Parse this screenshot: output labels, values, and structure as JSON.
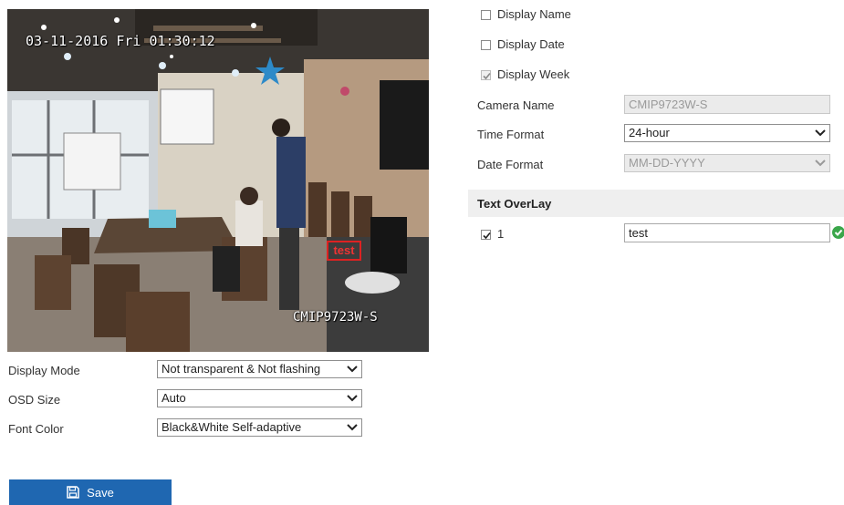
{
  "preview": {
    "osd_datetime": "03-11-2016 Fri 01:30:12",
    "osd_camera_name": "CMIP9723W-S",
    "osd_text_overlay": "test"
  },
  "display_options": [
    {
      "label": "Display Name",
      "checked": false,
      "disabled": false
    },
    {
      "label": "Display Date",
      "checked": false,
      "disabled": false
    },
    {
      "label": "Display Week",
      "checked": true,
      "disabled": true
    }
  ],
  "camera_name": {
    "label": "Camera Name",
    "value": "CMIP9723W-S"
  },
  "time_format": {
    "label": "Time Format",
    "value": "24-hour"
  },
  "date_format": {
    "label": "Date Format",
    "value": "MM-DD-YYYY"
  },
  "text_overlay": {
    "title": "Text OverLay",
    "items": [
      {
        "index": "1",
        "checked": true,
        "value": "test"
      }
    ]
  },
  "display_mode": {
    "label": "Display Mode",
    "value": "Not transparent & Not flashing"
  },
  "osd_size": {
    "label": "OSD Size",
    "value": "Auto"
  },
  "font_color": {
    "label": "Font Color",
    "value": "Black&White Self-adaptive"
  },
  "save_button": {
    "label": "Save",
    "icon": "floppy-disk-icon"
  },
  "colors": {
    "accent": "#1f67b1",
    "valid": "#3aa64a",
    "overlay_box": "#d22222"
  }
}
